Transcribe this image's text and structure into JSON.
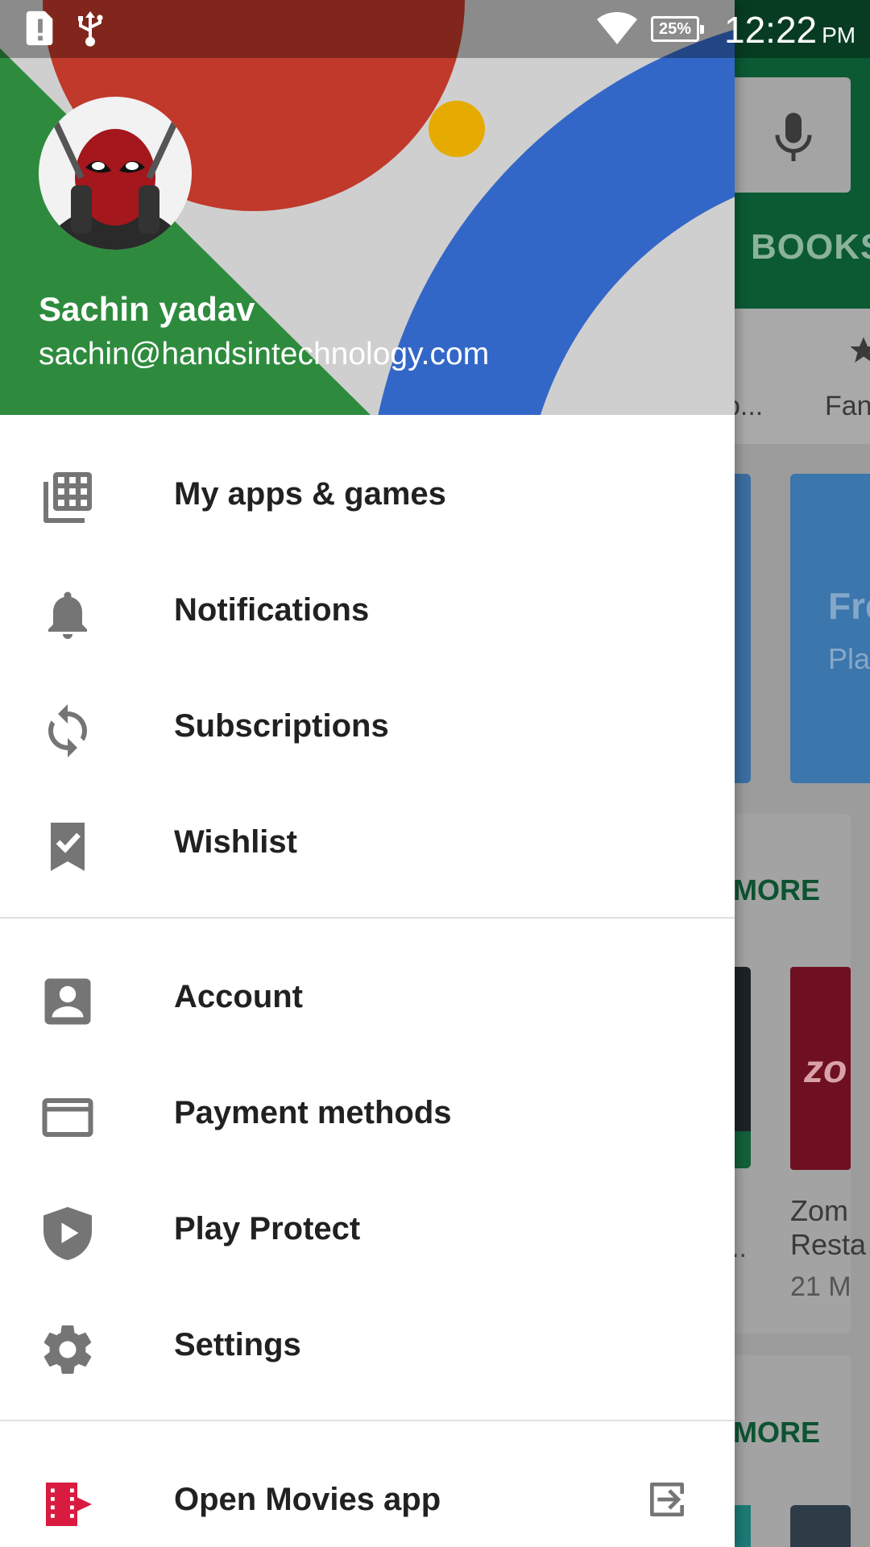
{
  "status_bar": {
    "time": "12:22",
    "period": "PM",
    "battery": "25%",
    "icons": [
      "alert-icon",
      "usb-icon",
      "wifi-icon",
      "battery-icon"
    ]
  },
  "background": {
    "tab_label": "BOOKS",
    "chip_1": "o...",
    "chip_2": "Fan",
    "promo_title": "Fre",
    "promo_subtitle": "Pla",
    "more_1": "MORE",
    "more_2": "MORE",
    "tile_logo": "zo",
    "app_name": "Zom\nResta",
    "app_dots": "..",
    "app_size": "21 M"
  },
  "drawer": {
    "user_name": "Sachin yadav",
    "user_email": "sachin@handsintechnology.com",
    "section_1": [
      {
        "label": "My apps & games",
        "icon": "apps-grid-icon"
      },
      {
        "label": "Notifications",
        "icon": "bell-icon"
      },
      {
        "label": "Subscriptions",
        "icon": "refresh-icon"
      },
      {
        "label": "Wishlist",
        "icon": "bookmark-check-icon"
      }
    ],
    "section_2": [
      {
        "label": "Account",
        "icon": "account-icon"
      },
      {
        "label": "Payment methods",
        "icon": "credit-card-icon"
      },
      {
        "label": "Play Protect",
        "icon": "shield-play-icon"
      },
      {
        "label": "Settings",
        "icon": "gear-icon"
      }
    ],
    "footer_item": {
      "label": "Open Movies app",
      "icon": "movies-icon",
      "trailing_icon": "exit-icon"
    }
  },
  "colors": {
    "header_green": "#2e8b3e",
    "header_red": "#c0392b",
    "header_blue": "#3367c7",
    "header_yellow": "#e6ab00",
    "header_gray": "#cfcfcf",
    "icon_gray": "#757575",
    "movies_red": "#d81b3f",
    "text_dark": "#212121"
  }
}
